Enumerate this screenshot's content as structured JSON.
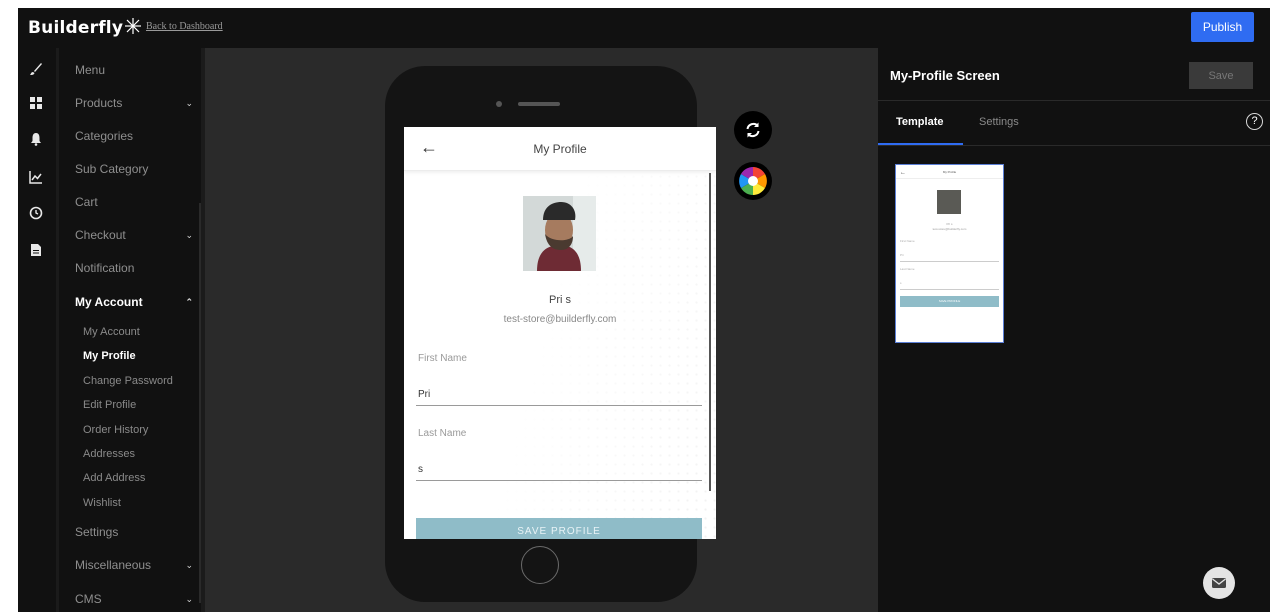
{
  "topbar": {
    "brand": "Builderfly",
    "back_link": "Back to Dashboard",
    "publish_label": "Publish",
    "accent_color": "#2f6cf2"
  },
  "rail_icons": [
    "brush-icon",
    "grid-icon",
    "bell-icon",
    "chart-icon",
    "clock-icon",
    "file-icon"
  ],
  "nav": {
    "items": [
      {
        "label": "Menu",
        "has_chevron": false
      },
      {
        "label": "Products",
        "has_chevron": true,
        "chevron": "⌄"
      },
      {
        "label": "Categories",
        "has_chevron": false
      },
      {
        "label": "Sub Category",
        "has_chevron": false
      },
      {
        "label": "Cart",
        "has_chevron": false
      },
      {
        "label": "Checkout",
        "has_chevron": true,
        "chevron": "⌄"
      },
      {
        "label": "Notification",
        "has_chevron": false
      },
      {
        "label": "My Account",
        "has_chevron": true,
        "chevron": "⌃",
        "active": true
      },
      {
        "label": "Settings",
        "has_chevron": false
      },
      {
        "label": "Miscellaneous",
        "has_chevron": true,
        "chevron": "⌄"
      },
      {
        "label": "CMS",
        "has_chevron": true,
        "chevron": "⌄"
      }
    ],
    "sub_items": [
      {
        "label": "My Account"
      },
      {
        "label": "My Profile",
        "active": true
      },
      {
        "label": "Change Password"
      },
      {
        "label": "Edit Profile"
      },
      {
        "label": "Order History"
      },
      {
        "label": "Addresses"
      },
      {
        "label": "Add Address"
      },
      {
        "label": "Wishlist"
      }
    ]
  },
  "preview": {
    "back_glyph": "←",
    "title": "My Profile",
    "name": "Pri s",
    "email": "test-store@builderfly.com",
    "first_name_label": "First Name",
    "first_name_value": "Pri",
    "last_name_label": "Last Name",
    "last_name_value": "s",
    "save_label": "SAVE PROFILE",
    "button_color": "#8fbcc8"
  },
  "panel": {
    "title": "My-Profile Screen",
    "save_label": "Save",
    "tabs": [
      {
        "label": "Template",
        "active": true
      },
      {
        "label": "Settings",
        "active": false
      }
    ],
    "help_glyph": "?"
  },
  "thumbnail": {
    "title": "My Profile",
    "name": "Pri s",
    "email": "test-store@builderfly.com",
    "first_name_label": "First Name",
    "first_name_value": "Pri",
    "last_name_label": "Last Name",
    "last_name_value": "s",
    "save_label": "SAVE PROFILE"
  }
}
